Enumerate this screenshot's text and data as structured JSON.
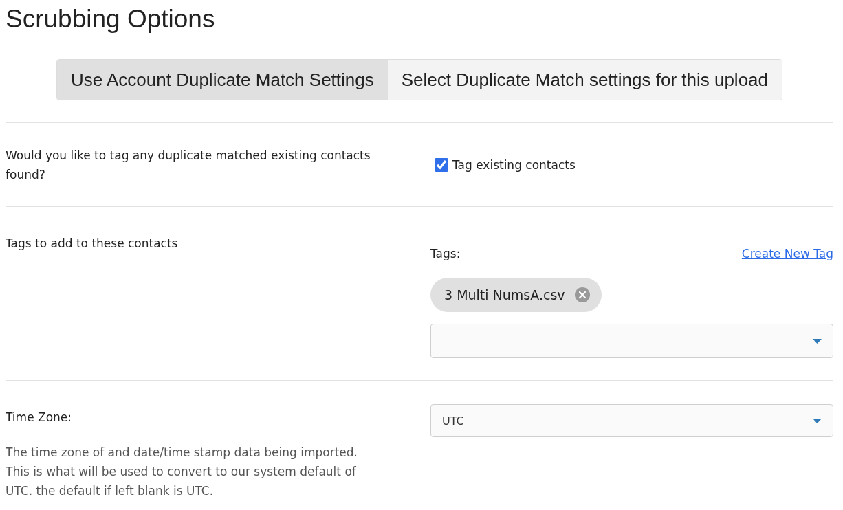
{
  "title": "Scrubbing Options",
  "match_mode_tabs": [
    {
      "label": "Use Account Duplicate Match Settings",
      "selected": true
    },
    {
      "label": "Select Duplicate Match settings for this upload",
      "selected": false
    }
  ],
  "sections": [
    {
      "kind": "checkbox",
      "label": "Would you like to tag any duplicate matched existing contacts found?",
      "checkbox": {
        "label": "Tag existing contacts",
        "checked": true
      }
    },
    {
      "kind": "tags",
      "label": "Tags to add to these contacts",
      "field_label": "Tags:",
      "link": "Create New Tag",
      "tags": [
        "3 Multi NumsA.csv"
      ]
    },
    {
      "kind": "select",
      "label": "Time Zone:",
      "description": "The time zone of and date/time stamp data being imported. This is what will be used to convert to our system default of UTC. the default if left blank is UTC.",
      "value": "UTC"
    }
  ]
}
